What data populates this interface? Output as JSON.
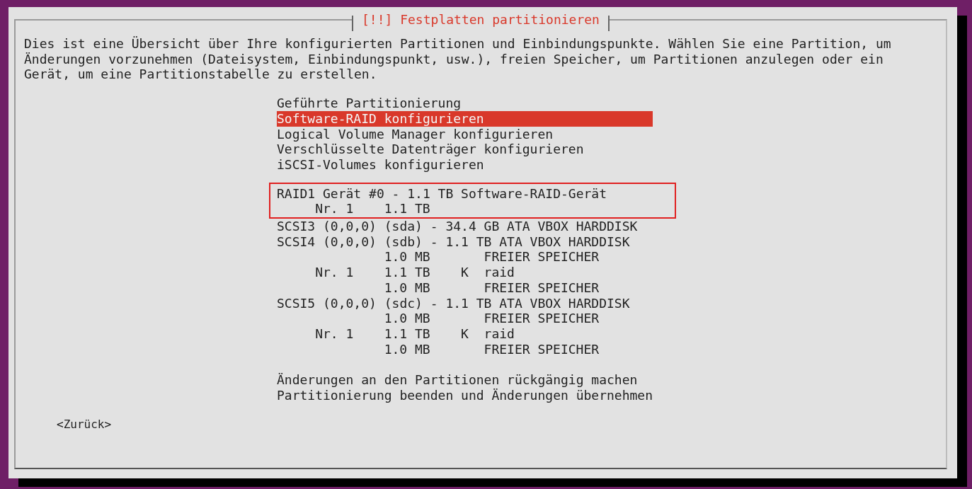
{
  "dialog": {
    "title": "[!!] Festplatten partitionieren",
    "description": [
      "Dies ist eine Übersicht über Ihre konfigurierten Partitionen und Einbindungspunkte. Wählen Sie eine Partition, um",
      "Änderungen vorzunehmen (Dateisystem, Einbindungspunkt, usw.), freien Speicher, um Partitionen anzulegen oder ein",
      "Gerät, um eine Partitionstabelle zu erstellen."
    ],
    "sections": [
      {
        "spaced": false,
        "marked": false,
        "items": [
          {
            "kind": "action",
            "text": "Geführte Partitionierung",
            "selected": false
          },
          {
            "kind": "action",
            "text": "Software-RAID konfigurieren",
            "selected": true
          },
          {
            "kind": "action",
            "text": "Logical Volume Manager konfigurieren",
            "selected": false
          },
          {
            "kind": "action",
            "text": "Verschlüsselte Datenträger konfigurieren",
            "selected": false
          },
          {
            "kind": "action",
            "text": "iSCSI-Volumes konfigurieren",
            "selected": false
          }
        ]
      },
      {
        "spaced": true,
        "marked": true,
        "items": [
          {
            "kind": "device",
            "text": "RAID1 Gerät #0 - 1.1 TB Software-RAID-Gerät",
            "selected": false
          },
          {
            "kind": "partition",
            "number": "Nr. 1",
            "size": "1.1 TB",
            "selected": false
          }
        ]
      },
      {
        "spaced": false,
        "marked": false,
        "items": [
          {
            "kind": "device",
            "text": "SCSI3 (0,0,0) (sda) - 34.4 GB ATA VBOX HARDDISK",
            "selected": false
          },
          {
            "kind": "device",
            "text": "SCSI4 (0,0,0) (sdb) - 1.1 TB ATA VBOX HARDDISK",
            "selected": false
          },
          {
            "kind": "partition",
            "size": "1.0 MB",
            "type": "FREIER SPEICHER",
            "selected": false
          },
          {
            "kind": "partition",
            "number": "Nr. 1",
            "size": "1.1 TB",
            "flag": "K",
            "type": "raid",
            "selected": false
          },
          {
            "kind": "partition",
            "size": "1.0 MB",
            "type": "FREIER SPEICHER",
            "selected": false
          },
          {
            "kind": "device",
            "text": "SCSI5 (0,0,0) (sdc) - 1.1 TB ATA VBOX HARDDISK",
            "selected": false
          },
          {
            "kind": "partition",
            "size": "1.0 MB",
            "type": "FREIER SPEICHER",
            "selected": false
          },
          {
            "kind": "partition",
            "number": "Nr. 1",
            "size": "1.1 TB",
            "flag": "K",
            "type": "raid",
            "selected": false
          },
          {
            "kind": "partition",
            "size": "1.0 MB",
            "type": "FREIER SPEICHER",
            "selected": false
          }
        ]
      },
      {
        "spaced": true,
        "marked": false,
        "items": [
          {
            "kind": "action",
            "text": "Änderungen an den Partitionen rückgängig machen",
            "selected": false
          },
          {
            "kind": "action",
            "text": "Partitionierung beenden und Änderungen übernehmen",
            "selected": false
          }
        ]
      }
    ],
    "back_button": "<Zurück>"
  }
}
